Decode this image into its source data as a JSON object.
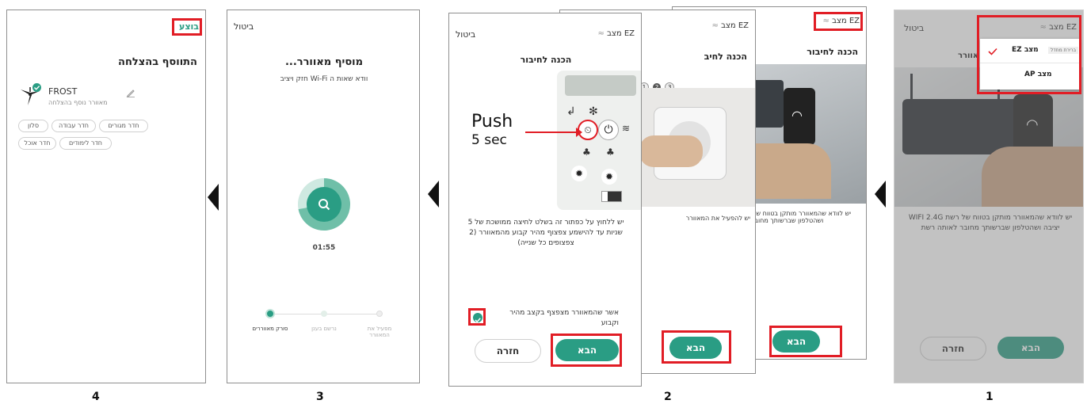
{
  "steps": [
    "4",
    "3",
    "2",
    "1"
  ],
  "screen4": {
    "done_label": "בוצע",
    "title": "התווסף בהצלחה",
    "device_name": "FROST",
    "device_subtitle": "מאוורר נוסף בהצלחה",
    "rooms": [
      "סלון",
      "חדר עבודה",
      "חדר מגורים",
      "חדר אוכל",
      "חדר לימודים"
    ]
  },
  "screen3": {
    "cancel_label": "ביטול",
    "title": "מוסיף מאוורר...",
    "subtitle": "וודא שאות ה Wi-Fi חזק ויציב",
    "timer": "01:55",
    "progress": 0.72,
    "steps": [
      {
        "label": "סורק מאווררים"
      },
      {
        "label": "נרשם בענן"
      },
      {
        "label": "מפעיל את המאוורר"
      }
    ]
  },
  "screen2": {
    "mode_label": "מצב EZ",
    "cancel_label": "ביטול",
    "title": "הכנה לחיבור",
    "push_label": "Push",
    "push_sec": "5 sec",
    "instructions": "יש ללחוץ על כפתור זה בשלט לחיצה ממושכת של 5 שניות עד להישמע צפצוף מהיר קבוע מהמאוורר (2 צפצופים כל שנייה)",
    "confirm_label": "אשר שהמאוורר מצפצף בקצב מהיר וקבוע",
    "next_label": "הבא",
    "back_label": "חזרה",
    "back_card_mode": "מצב EZ",
    "back_card_title": "הכנה לחיבור",
    "back_card_title_partial": "הכנה לחיב",
    "back_card_text": "יש להפעיל את המאוורר",
    "back_card_step_nums": [
      "1",
      "2",
      "3"
    ],
    "back_card2_text": "יש לוודא שהמאוורר מותקן בטווח של רשת WIFI 2.4G יציבה ושהטלפון שברשותך מחובר לאותה רשת"
  },
  "screen1": {
    "cancel_label": "ביטול",
    "mode_label": "מצב EZ",
    "menu_option_ez": "מצב EZ",
    "menu_option_ez_badge": "ברירת מחדל",
    "menu_option_ap": "מצב AP",
    "title_partial": "אוורר",
    "instructions": "יש לוודא שהמאוורר מותקן בטווח של רשת WIFI 2.4G יציבה ושהטלפון שברשותך מחובר לאותה רשת",
    "next_label": "הבא",
    "back_label": "חזרה"
  },
  "colors": {
    "accent": "#2a9d84",
    "highlight": "#e11d25"
  }
}
